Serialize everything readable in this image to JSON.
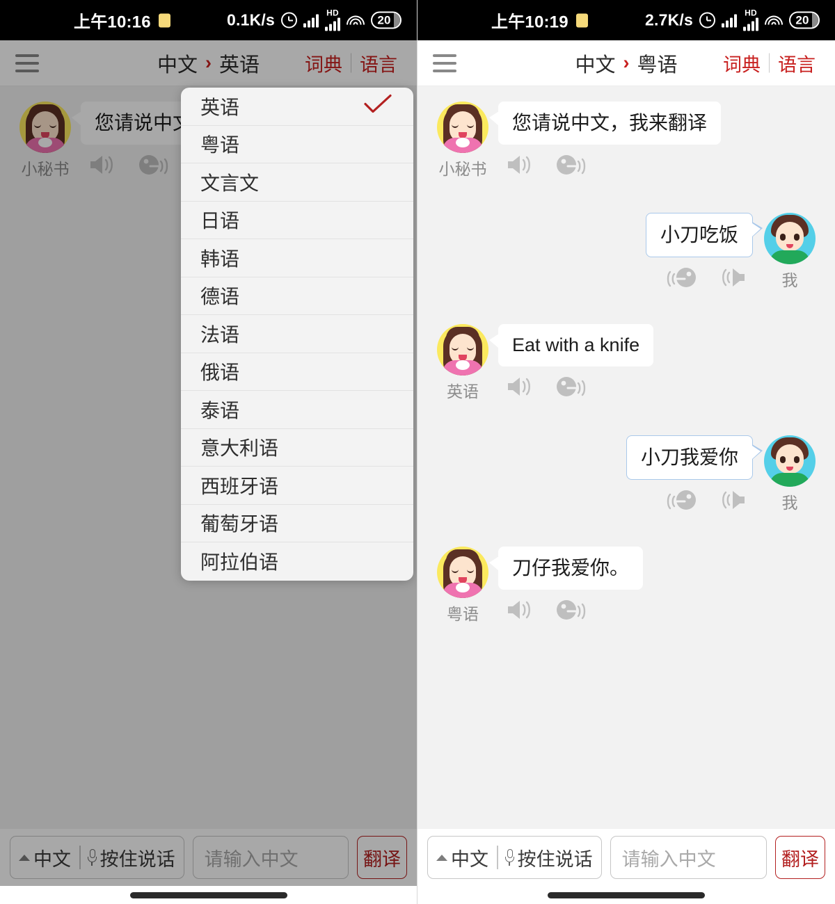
{
  "app": {
    "hamburger_icon": "hamburger-menu-icon",
    "arrow_glyph": "›",
    "dictionary_label": "词典",
    "language_label": "语言",
    "accent_red": "#c8201f",
    "user_bubble_border": "#a9c8ea"
  },
  "left": {
    "status": {
      "time": "上午10:16",
      "speed": "0.1K/s",
      "hd_label": "HD",
      "battery": "20",
      "icons": [
        "alarm-icon",
        "signal-bars-icon",
        "hd-signal-icon",
        "wifi-icon",
        "battery-icon"
      ]
    },
    "header": {
      "source_lang": "中文",
      "target_lang": "英语"
    },
    "messages": [
      {
        "side": "left",
        "who": "小秘书",
        "text": "您请说中文，我来翻译",
        "avatar": "assistant-girl-avatar",
        "actions": [
          "speaker-icon",
          "talking-head-icon"
        ]
      }
    ],
    "dropdown": {
      "selected": "英语",
      "check_icon": "check-mark-icon",
      "items": [
        "英语",
        "粤语",
        "文言文",
        "日语",
        "韩语",
        "德语",
        "法语",
        "俄语",
        "泰语",
        "意大利语",
        "西班牙语",
        "葡萄牙语",
        "阿拉伯语"
      ]
    },
    "bottom": {
      "lang_label": "中文",
      "hold_to_talk": "按住说话",
      "input_value": "",
      "input_placeholder": "请输入中文",
      "translate_label": "翻译",
      "mic_icon": "microphone-icon",
      "caret_icon": "caret-up-icon"
    }
  },
  "right": {
    "status": {
      "time": "上午10:19",
      "speed": "2.7K/s",
      "hd_label": "HD",
      "battery": "20",
      "icons": [
        "alarm-icon",
        "signal-bars-icon",
        "hd-signal-icon",
        "wifi-icon",
        "battery-icon"
      ]
    },
    "header": {
      "source_lang": "中文",
      "target_lang": "粤语"
    },
    "messages": [
      {
        "side": "left",
        "who": "小秘书",
        "text": "您请说中文，我来翻译",
        "avatar": "assistant-girl-avatar",
        "actions": [
          "speaker-icon",
          "talking-head-icon"
        ]
      },
      {
        "side": "right",
        "who": "我",
        "text": "小刀吃饭",
        "avatar": "user-boy-avatar",
        "actions": [
          "talking-head-icon",
          "speaker-icon"
        ]
      },
      {
        "side": "left",
        "who": "英语",
        "text": "Eat with a knife",
        "avatar": "assistant-girl-avatar",
        "actions": [
          "speaker-icon",
          "talking-head-icon"
        ]
      },
      {
        "side": "right",
        "who": "我",
        "text": "小刀我爱你",
        "avatar": "user-boy-avatar",
        "actions": [
          "talking-head-icon",
          "speaker-icon"
        ]
      },
      {
        "side": "left",
        "who": "粤语",
        "text": "刀仔我爱你。",
        "avatar": "assistant-girl-avatar",
        "actions": [
          "speaker-icon",
          "talking-head-icon"
        ]
      }
    ],
    "bottom": {
      "lang_label": "中文",
      "hold_to_talk": "按住说话",
      "input_value": "",
      "input_placeholder": "请输入中文",
      "translate_label": "翻译",
      "mic_icon": "microphone-icon",
      "caret_icon": "caret-up-icon"
    }
  }
}
